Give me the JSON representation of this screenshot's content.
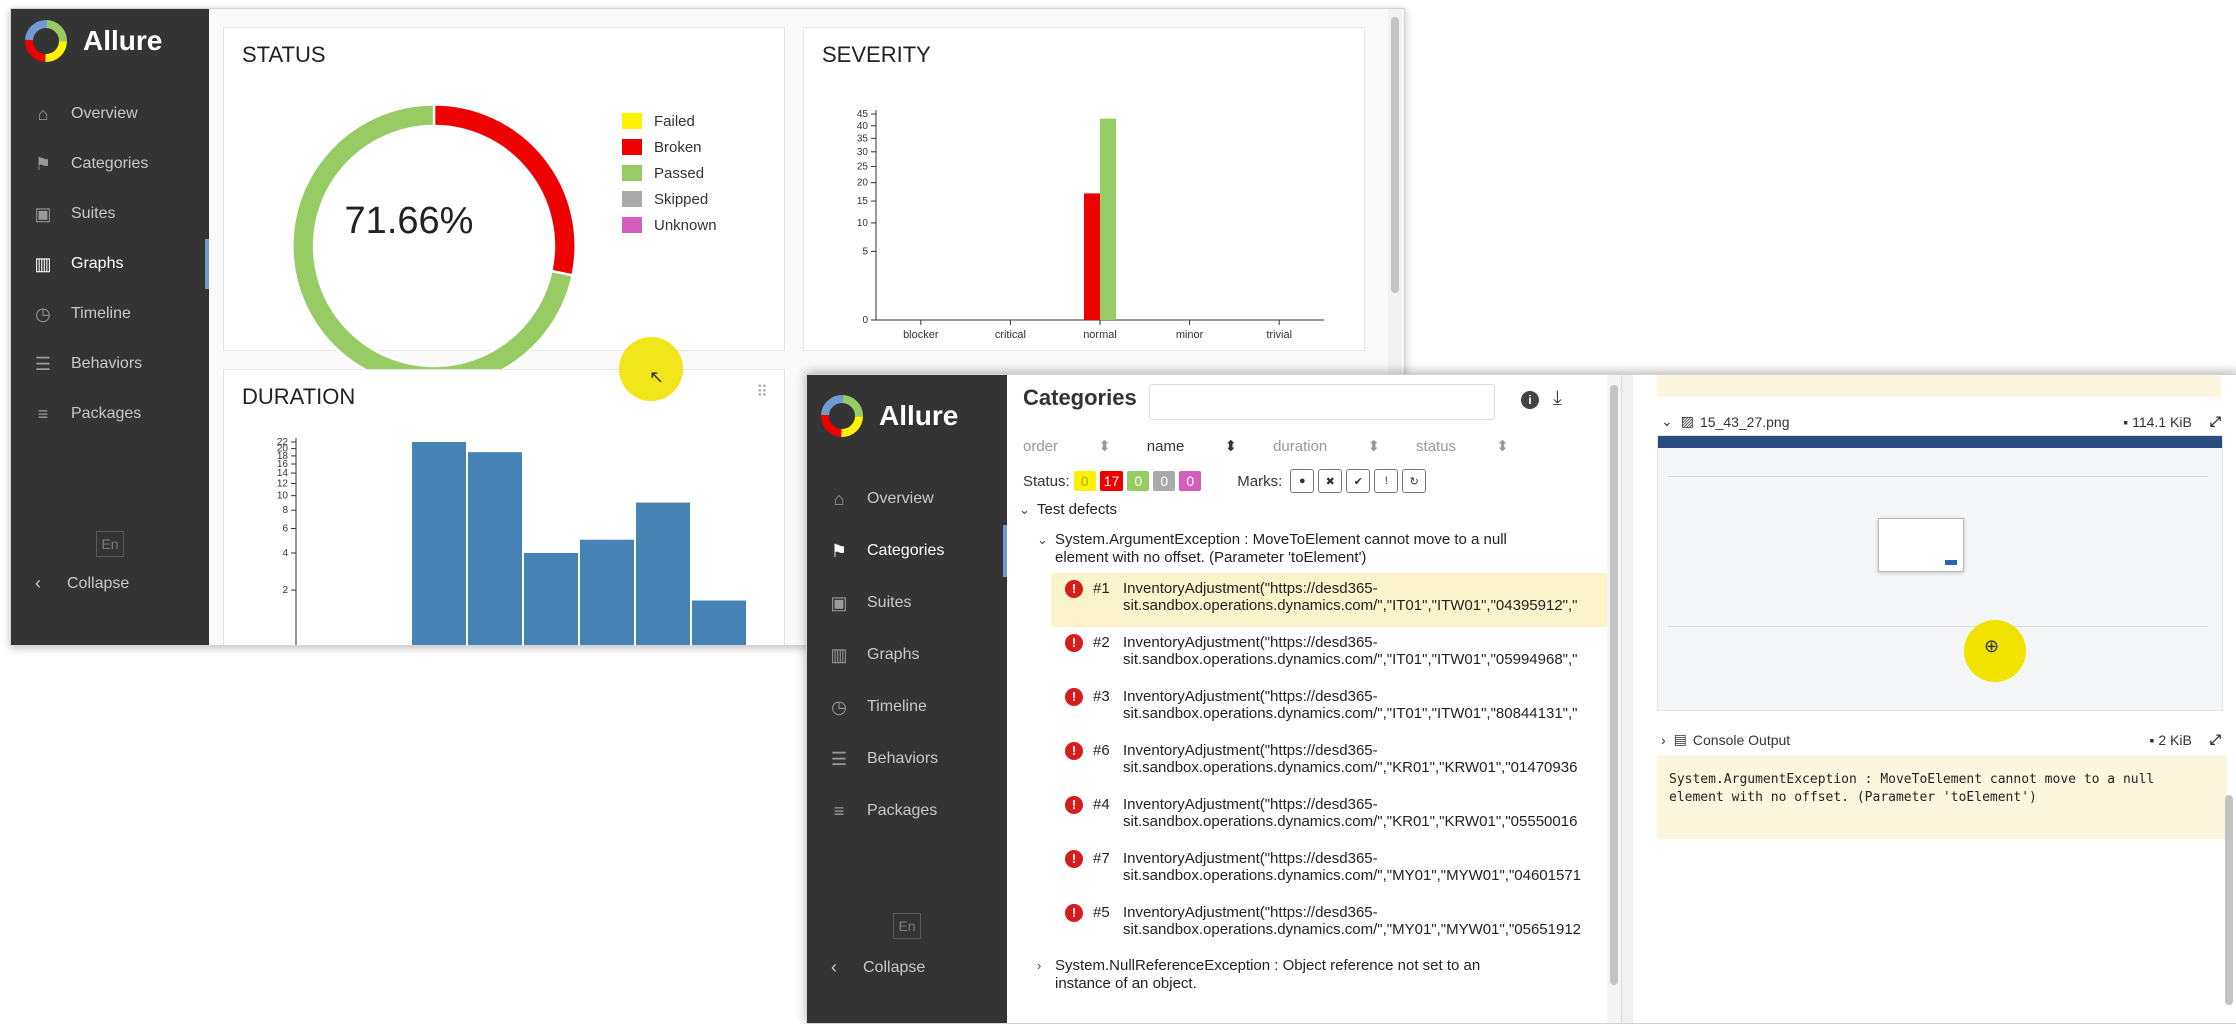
{
  "brand": "Allure",
  "nav": [
    {
      "label": "Overview",
      "icon": "home-icon"
    },
    {
      "label": "Categories",
      "icon": "flag-icon"
    },
    {
      "label": "Suites",
      "icon": "briefcase-icon"
    },
    {
      "label": "Graphs",
      "icon": "bar-chart-icon"
    },
    {
      "label": "Timeline",
      "icon": "clock-icon"
    },
    {
      "label": "Behaviors",
      "icon": "list-icon"
    },
    {
      "label": "Packages",
      "icon": "packages-icon"
    }
  ],
  "lang": "En",
  "collapse_label": "Collapse",
  "graphs": {
    "status": {
      "title": "STATUS",
      "percent": "71.66%",
      "legend": [
        {
          "label": "Failed",
          "color": "#fff200"
        },
        {
          "label": "Broken",
          "color": "#ee0000"
        },
        {
          "label": "Passed",
          "color": "#97cc64"
        },
        {
          "label": "Skipped",
          "color": "#aaaaaa"
        },
        {
          "label": "Unknown",
          "color": "#d35ebe"
        }
      ]
    },
    "severity_title": "SEVERITY",
    "duration_title": "DURATION"
  },
  "chart_data": [
    {
      "type": "pie",
      "title": "STATUS",
      "labels": [
        "Failed",
        "Broken",
        "Passed",
        "Skipped",
        "Unknown"
      ],
      "values": [
        0,
        17,
        43,
        0,
        0
      ]
    },
    {
      "type": "bar",
      "title": "SEVERITY",
      "categories": [
        "blocker",
        "critical",
        "normal",
        "minor",
        "trivial"
      ],
      "series": [
        {
          "name": "Broken",
          "color": "#ee0000",
          "values": [
            0,
            0,
            17,
            0,
            0
          ]
        },
        {
          "name": "Passed",
          "color": "#97cc64",
          "values": [
            0,
            0,
            43,
            0,
            0
          ]
        }
      ],
      "yticks": [
        0,
        5,
        10,
        15,
        20,
        25,
        30,
        35,
        40,
        45
      ],
      "ylim": [
        0,
        45
      ],
      "yscale": "sqrt"
    },
    {
      "type": "bar",
      "title": "DURATION",
      "values": [
        22,
        19,
        4,
        5,
        9,
        1.6
      ],
      "yticks": [
        2,
        4,
        6,
        8,
        10,
        12,
        14,
        16,
        18,
        20,
        22
      ],
      "ylim": [
        0,
        22
      ],
      "yscale": "log"
    }
  ],
  "categories": {
    "title": "Categories",
    "sort": [
      "order",
      "name",
      "duration",
      "status"
    ],
    "status_label": "Status:",
    "status_counts": [
      {
        "value": "0",
        "color": "#fff200",
        "text": "#aaaa00"
      },
      {
        "value": "17",
        "color": "#ee0000",
        "text": "#ffffff"
      },
      {
        "value": "0",
        "color": "#97cc64",
        "text": "#ffffff"
      },
      {
        "value": "0",
        "color": "#aaaaaa",
        "text": "#ffffff"
      },
      {
        "value": "0",
        "color": "#d35ebe",
        "text": "#ffffff"
      }
    ],
    "marks_label": "Marks:",
    "group": "Test defects",
    "subgroup": "System.ArgumentException : MoveToElement cannot move to a null element with no offset. (Parameter 'toElement')",
    "subgroup_line1": "System.ArgumentException : MoveToElement cannot move to a null",
    "subgroup_line2": "element with no offset. (Parameter 'toElement')",
    "rows": [
      {
        "num": "#1",
        "l1": "InventoryAdjustment(\"https://desd365-",
        "l2": "sit.sandbox.operations.dynamics.com/\",\"IT01\",\"ITW01\",\"04395912\",\""
      },
      {
        "num": "#2",
        "l1": "InventoryAdjustment(\"https://desd365-",
        "l2": "sit.sandbox.operations.dynamics.com/\",\"IT01\",\"ITW01\",\"05994968\",\""
      },
      {
        "num": "#3",
        "l1": "InventoryAdjustment(\"https://desd365-",
        "l2": "sit.sandbox.operations.dynamics.com/\",\"IT01\",\"ITW01\",\"80844131\",\""
      },
      {
        "num": "#6",
        "l1": "InventoryAdjustment(\"https://desd365-",
        "l2": "sit.sandbox.operations.dynamics.com/\",\"KR01\",\"KRW01\",\"01470936"
      },
      {
        "num": "#4",
        "l1": "InventoryAdjustment(\"https://desd365-",
        "l2": "sit.sandbox.operations.dynamics.com/\",\"KR01\",\"KRW01\",\"05550016"
      },
      {
        "num": "#7",
        "l1": "InventoryAdjustment(\"https://desd365-",
        "l2": "sit.sandbox.operations.dynamics.com/\",\"MY01\",\"MYW01\",\"04601571"
      },
      {
        "num": "#5",
        "l1": "InventoryAdjustment(\"https://desd365-",
        "l2": "sit.sandbox.operations.dynamics.com/\",\"MY01\",\"MYW01\",\"05651912"
      }
    ],
    "next_group_line1": "System.NullReferenceException : Object reference not set to an",
    "next_group_line2": "instance of an object."
  },
  "detail": {
    "attachment1": {
      "name": "15_43_27.png",
      "size": "114.1 KiB"
    },
    "attachment2": {
      "name": "Console Output",
      "size": "2 KiB"
    },
    "console_text": "System.ArgumentException : MoveToElement cannot move to a null\nelement with no offset. (Parameter 'toElement')"
  }
}
